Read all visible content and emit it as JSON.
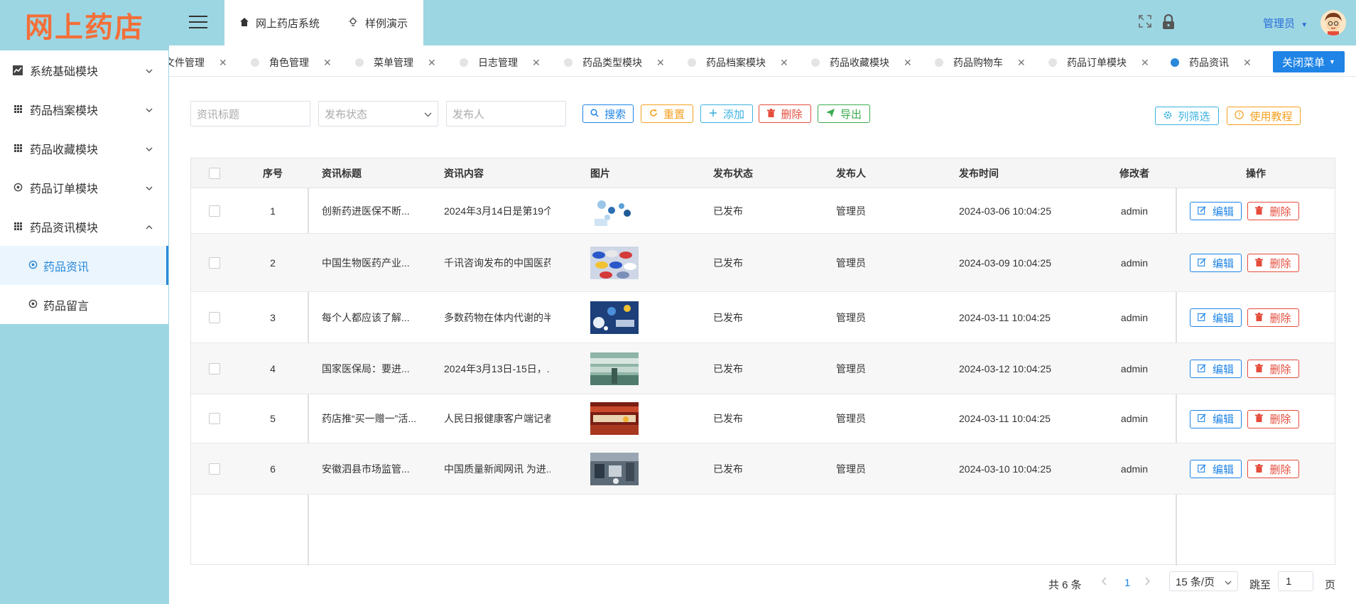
{
  "sidebar": {
    "logo": "网上药店",
    "items": [
      {
        "label": "系统基础模块",
        "icon": "chart-icon",
        "arrow": "down"
      },
      {
        "label": "药品档案模块",
        "icon": "grid-icon",
        "arrow": "down"
      },
      {
        "label": "药品收藏模块",
        "icon": "grid-icon",
        "arrow": "down"
      },
      {
        "label": "药品订单模块",
        "icon": "settings-icon",
        "arrow": "down"
      },
      {
        "label": "药品资讯模块",
        "icon": "grid-icon",
        "arrow": "up"
      }
    ],
    "subitems": [
      {
        "label": "药品资讯",
        "active": true
      },
      {
        "label": "药品留言",
        "active": false
      }
    ]
  },
  "header": {
    "tabs": [
      {
        "label": "网上药店系统",
        "icon": "home-icon"
      },
      {
        "label": "样例演示",
        "icon": "bulb-icon"
      }
    ],
    "user": "管理员"
  },
  "tagbar": {
    "tags": [
      "文件管理",
      "角色管理",
      "菜单管理",
      "日志管理",
      "药品类型模块",
      "药品档案模块",
      "药品收藏模块",
      "药品购物车",
      "药品订单模块",
      "药品资讯"
    ],
    "active": "药品资讯",
    "close_menu": "关闭菜单"
  },
  "search": {
    "title_placeholder": "资讯标题",
    "status_placeholder": "发布状态",
    "publisher_placeholder": "发布人",
    "search": "搜索",
    "reset": "重置",
    "add": "添加",
    "delete": "删除",
    "export": "导出",
    "filter": "列筛选",
    "tutorial": "使用教程"
  },
  "table": {
    "headers": [
      "序号",
      "资讯标题",
      "资讯内容",
      "图片",
      "发布状态",
      "发布人",
      "发布时间",
      "修改者",
      "操作"
    ],
    "edit_label": "编辑",
    "delete_label": "删除",
    "rows": [
      {
        "no": "1",
        "title": "创新药进医保不断...",
        "content": "2024年3月14日是第19个...",
        "status": "已发布",
        "publisher": "管理员",
        "time": "2024-03-06 10:04:25",
        "modifier": "admin"
      },
      {
        "no": "2",
        "title": "中国生物医药产业...",
        "content": "千讯咨询发布的中国医药...",
        "status": "已发布",
        "publisher": "管理员",
        "time": "2024-03-09 10:04:25",
        "modifier": "admin"
      },
      {
        "no": "3",
        "title": "每个人都应该了解...",
        "content": "多数药物在体内代谢的半...",
        "status": "已发布",
        "publisher": "管理员",
        "time": "2024-03-11 10:04:25",
        "modifier": "admin"
      },
      {
        "no": "4",
        "title": "国家医保局：要进...",
        "content": "2024年3月13日-15日，...",
        "status": "已发布",
        "publisher": "管理员",
        "time": "2024-03-12 10:04:25",
        "modifier": "admin"
      },
      {
        "no": "5",
        "title": "药店推“买一赠一”活...",
        "content": "人民日报健康客户端记者...",
        "status": "已发布",
        "publisher": "管理员",
        "time": "2024-03-11 10:04:25",
        "modifier": "admin"
      },
      {
        "no": "6",
        "title": "安徽泗县市场监管...",
        "content": "中国质量新闻网讯 为进...",
        "status": "已发布",
        "publisher": "管理员",
        "time": "2024-03-10 10:04:25",
        "modifier": "admin"
      }
    ]
  },
  "pagination": {
    "total": "共 6 条",
    "page": "1",
    "size": "15 条/页",
    "goto_label": "跳至",
    "goto_value": "1",
    "page_suffix": "页"
  },
  "colors": {
    "sidebar_bg": "#9dd6e3",
    "logo": "#f36f39",
    "accent": "#1f84e6",
    "danger": "#e54c3c"
  }
}
